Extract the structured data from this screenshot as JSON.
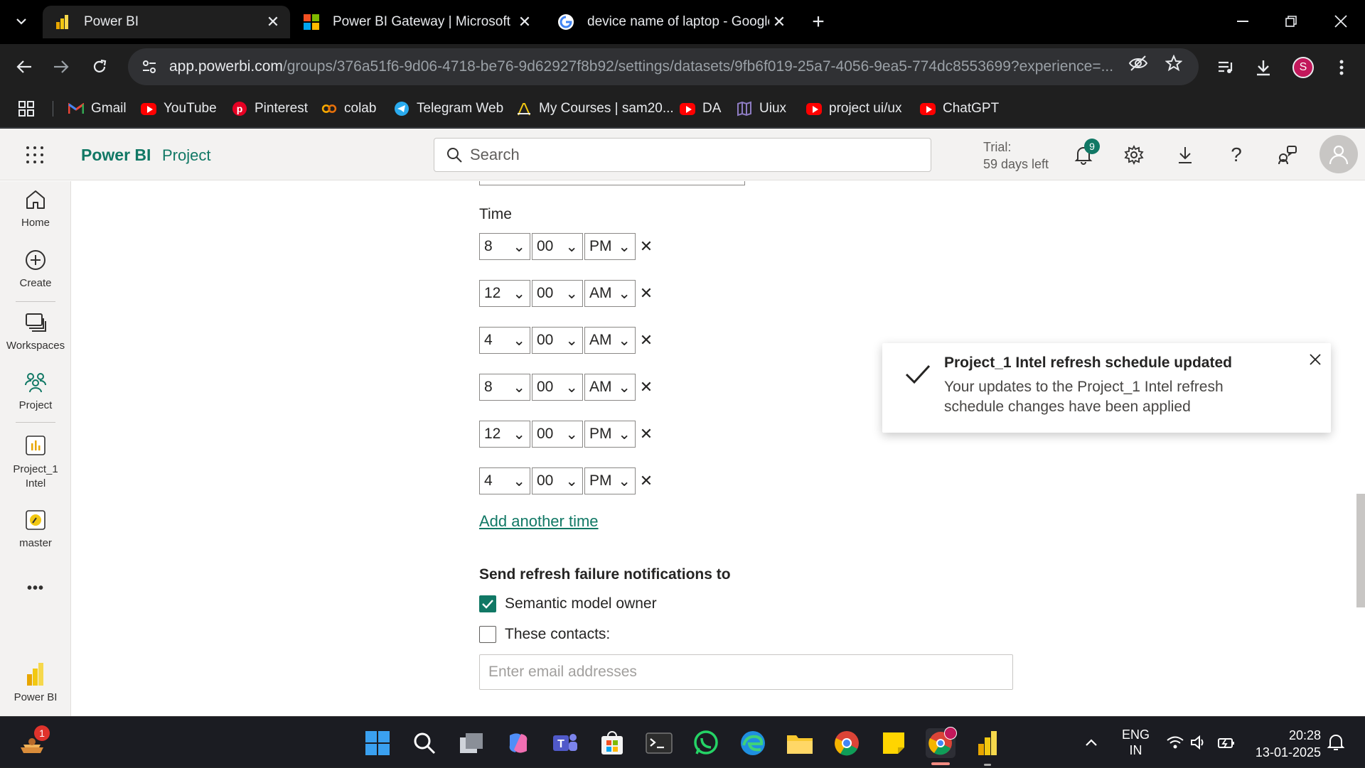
{
  "browser": {
    "tabs": [
      {
        "title": "Power BI",
        "active": true
      },
      {
        "title": "Power BI Gateway | Microsoft Po",
        "active": false
      },
      {
        "title": "device name of laptop - Google",
        "active": false
      }
    ],
    "new_tab": "+",
    "url_host": "app.powerbi.com",
    "url_path": "/groups/376a51f6-9d06-4718-be76-9d62927f8b92/settings/datasets/9fb6f019-25a7-4056-9ea5-774dc8553699?experience=...",
    "profile_initial": "S",
    "bookmarks": [
      {
        "label": "Gmail",
        "icon": "gmail-icon"
      },
      {
        "label": "YouTube",
        "icon": "youtube-icon"
      },
      {
        "label": "Pinterest",
        "icon": "pinterest-icon"
      },
      {
        "label": "colab",
        "icon": "colab-icon"
      },
      {
        "label": "Telegram Web",
        "icon": "telegram-icon"
      },
      {
        "label": "My Courses | sam20...",
        "icon": "courses-icon"
      },
      {
        "label": "DA",
        "icon": "youtube-icon"
      },
      {
        "label": "Uiux",
        "icon": "uiux-icon"
      },
      {
        "label": "project ui/ux",
        "icon": "youtube-icon"
      },
      {
        "label": "ChatGPT",
        "icon": "youtube-icon"
      }
    ]
  },
  "header": {
    "brand": "Power BI",
    "workspace": "Project",
    "search_placeholder": "Search",
    "trial_line1": "Trial:",
    "trial_line2": "59 days left",
    "notification_count": "9"
  },
  "leftnav": {
    "items": [
      {
        "label": "Home",
        "icon": "home-icon"
      },
      {
        "label": "Create",
        "icon": "plus-circle-icon"
      },
      {
        "label": "Workspaces",
        "icon": "workspaces-icon"
      },
      {
        "label": "Project",
        "icon": "people-icon"
      },
      {
        "label": "Project_1 Intel",
        "icon": "report-icon"
      },
      {
        "label": "master",
        "icon": "master-icon"
      }
    ],
    "more": "•••",
    "footer": "Power BI"
  },
  "schedule": {
    "time_label": "Time",
    "times": [
      {
        "hour": "8",
        "minute": "00",
        "ampm": "PM"
      },
      {
        "hour": "12",
        "minute": "00",
        "ampm": "AM"
      },
      {
        "hour": "4",
        "minute": "00",
        "ampm": "AM"
      },
      {
        "hour": "8",
        "minute": "00",
        "ampm": "AM"
      },
      {
        "hour": "12",
        "minute": "00",
        "ampm": "PM"
      },
      {
        "hour": "4",
        "minute": "00",
        "ampm": "PM"
      }
    ],
    "add_time": "Add another time",
    "notify_header": "Send refresh failure notifications to",
    "owner_label": "Semantic model owner",
    "owner_checked": true,
    "contacts_label": "These contacts:",
    "contacts_checked": false,
    "email_placeholder": "Enter email addresses"
  },
  "toast": {
    "title": "Project_1 Intel refresh schedule updated",
    "body": "Your updates to the Project_1 Intel refresh schedule changes have been applied"
  },
  "taskbar": {
    "widget_badge": "1",
    "lang1": "ENG",
    "lang2": "IN",
    "time": "20:28",
    "date": "13-01-2025"
  },
  "colors": {
    "accent": "#117865",
    "youtube": "#ff0000"
  }
}
